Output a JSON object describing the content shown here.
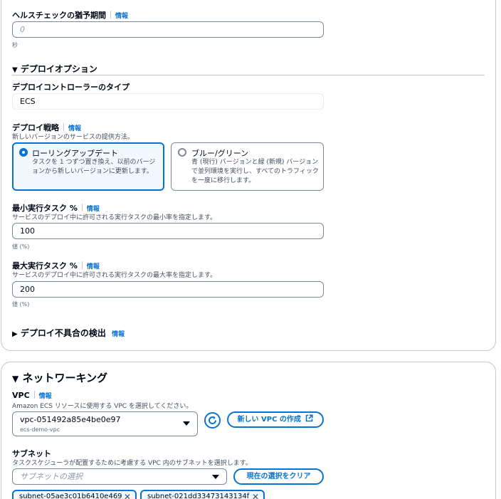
{
  "common": {
    "info_link": "情報"
  },
  "health_check": {
    "label": "ヘルスチェックの猶予期間",
    "placeholder": "0",
    "unit": "秒"
  },
  "deploy_options": {
    "title": "デプロイオプション",
    "controller_label": "デプロイコントローラーのタイプ",
    "controller_value": "ECS",
    "strategy_label": "デプロイ戦略",
    "strategy_desc": "新しいバージョンのサービスの提供方法。",
    "strategies": [
      {
        "title": "ローリングアップデート",
        "desc_line1": "タスクを 1 つずつ置き換え、以前のバージ",
        "desc_line2": "ョンから新しいバージョンに更新します。",
        "selected": true
      },
      {
        "title": "ブルー/グリーン",
        "desc_line1": "青 (現行) バージョンと緑 (新規) バージョン",
        "desc_line2": "で並列環境を実行し、すべてのトラフィック",
        "desc_line3": "を一度に移行します。",
        "selected": false
      }
    ],
    "min_tasks": {
      "label": "最小実行タスク %",
      "desc": "サービスのデプロイ中に許可される実行タスクの最小率を指定します。",
      "value": "100",
      "hint": "値 (%)"
    },
    "max_tasks": {
      "label": "最大実行タスク %",
      "desc": "サービスのデプロイ中に許可される実行タスクの最大率を指定します。",
      "value": "200",
      "hint": "値 (%)"
    },
    "failure_detection": {
      "title": "デプロイ不具合の検出"
    }
  },
  "networking": {
    "title": "ネットワーキング",
    "vpc": {
      "label": "VPC",
      "desc": "Amazon ECS リソースに使用する VPC を選択してください。",
      "selected_id": "vpc-051492a85e4be0e97",
      "selected_name": "ecs-demo-vpc",
      "create_button": "新しい VPC の作成"
    },
    "subnet": {
      "label": "サブネット",
      "desc": "タスクスケジューラが配置するために考慮する VPC 内のサブネットを選択します。",
      "placeholder": "サブネットの選択",
      "clear_button": "現在の選択をクリア",
      "tokens": [
        "subnet-05ae3c01b6410e469",
        "subnet-021dd33473143134f"
      ]
    }
  },
  "colors": {
    "accent": "#0972d3",
    "border": "#7d8998",
    "text": "#000716"
  }
}
